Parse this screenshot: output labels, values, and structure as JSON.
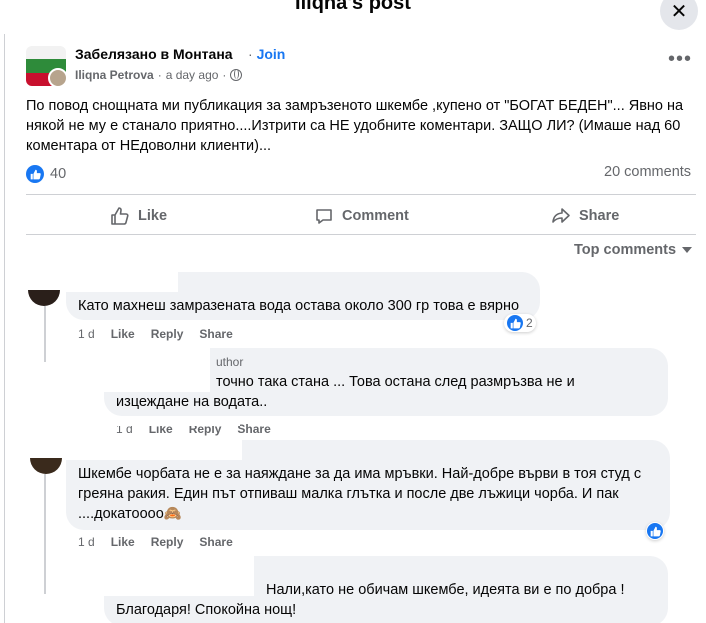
{
  "window": {
    "title": "Iliqna's post"
  },
  "post": {
    "group_name": "Забелязано в Монтана",
    "join_separator": "·",
    "join_label": "Join",
    "author": "Iliqna Petrova",
    "time": "a day ago",
    "text": "По повод снощната ми публикация за замръзеното шкембе ,купено от \"БОГАТ БЕДЕН\"... Явно на някой не му е станало приятно....Изтрити са НЕ удобните коментари.  ЗАЩО ЛИ?  (Имаше над 60 коментара от НЕдоволни клиенти)...",
    "reaction_count": "40",
    "comments_count": "20 comments"
  },
  "actions": {
    "like": "Like",
    "comment": "Comment",
    "share": "Share"
  },
  "sort": {
    "label": "Top comments"
  },
  "comments": [
    {
      "text": "Като махнеш замразената вода остава около 300 гр това е вярно",
      "time": "1 d",
      "like": "Like",
      "reply": "Reply",
      "share": "Share",
      "reactions": "2"
    },
    {
      "author_badge": "uthor",
      "text_line1": "точно така стана ... Това остана след размръзва не и",
      "text_line2": "изцеждане на водата..",
      "time": "1 d",
      "like": "Like",
      "reply": "Reply",
      "share": "Share"
    },
    {
      "text": "Шкембе чорбата не е за наяждане за да има мръвки. Най-добре върви в тоя студ с греяна ракия. Един път отпиваш малка глътка и после две лъжици чорба. И пак ....докатоооо🙈",
      "time": "1 d",
      "like": "Like",
      "reply": "Reply",
      "share": "Share"
    },
    {
      "text_line1": "Нали,като не обичам шкембе, идеята ви е по добра !",
      "text_line2": "Благодаря! Спокойна нощ!"
    }
  ],
  "colors": {
    "accent": "#1877f2",
    "bubble": "#f0f2f5",
    "muted": "#65676b"
  }
}
